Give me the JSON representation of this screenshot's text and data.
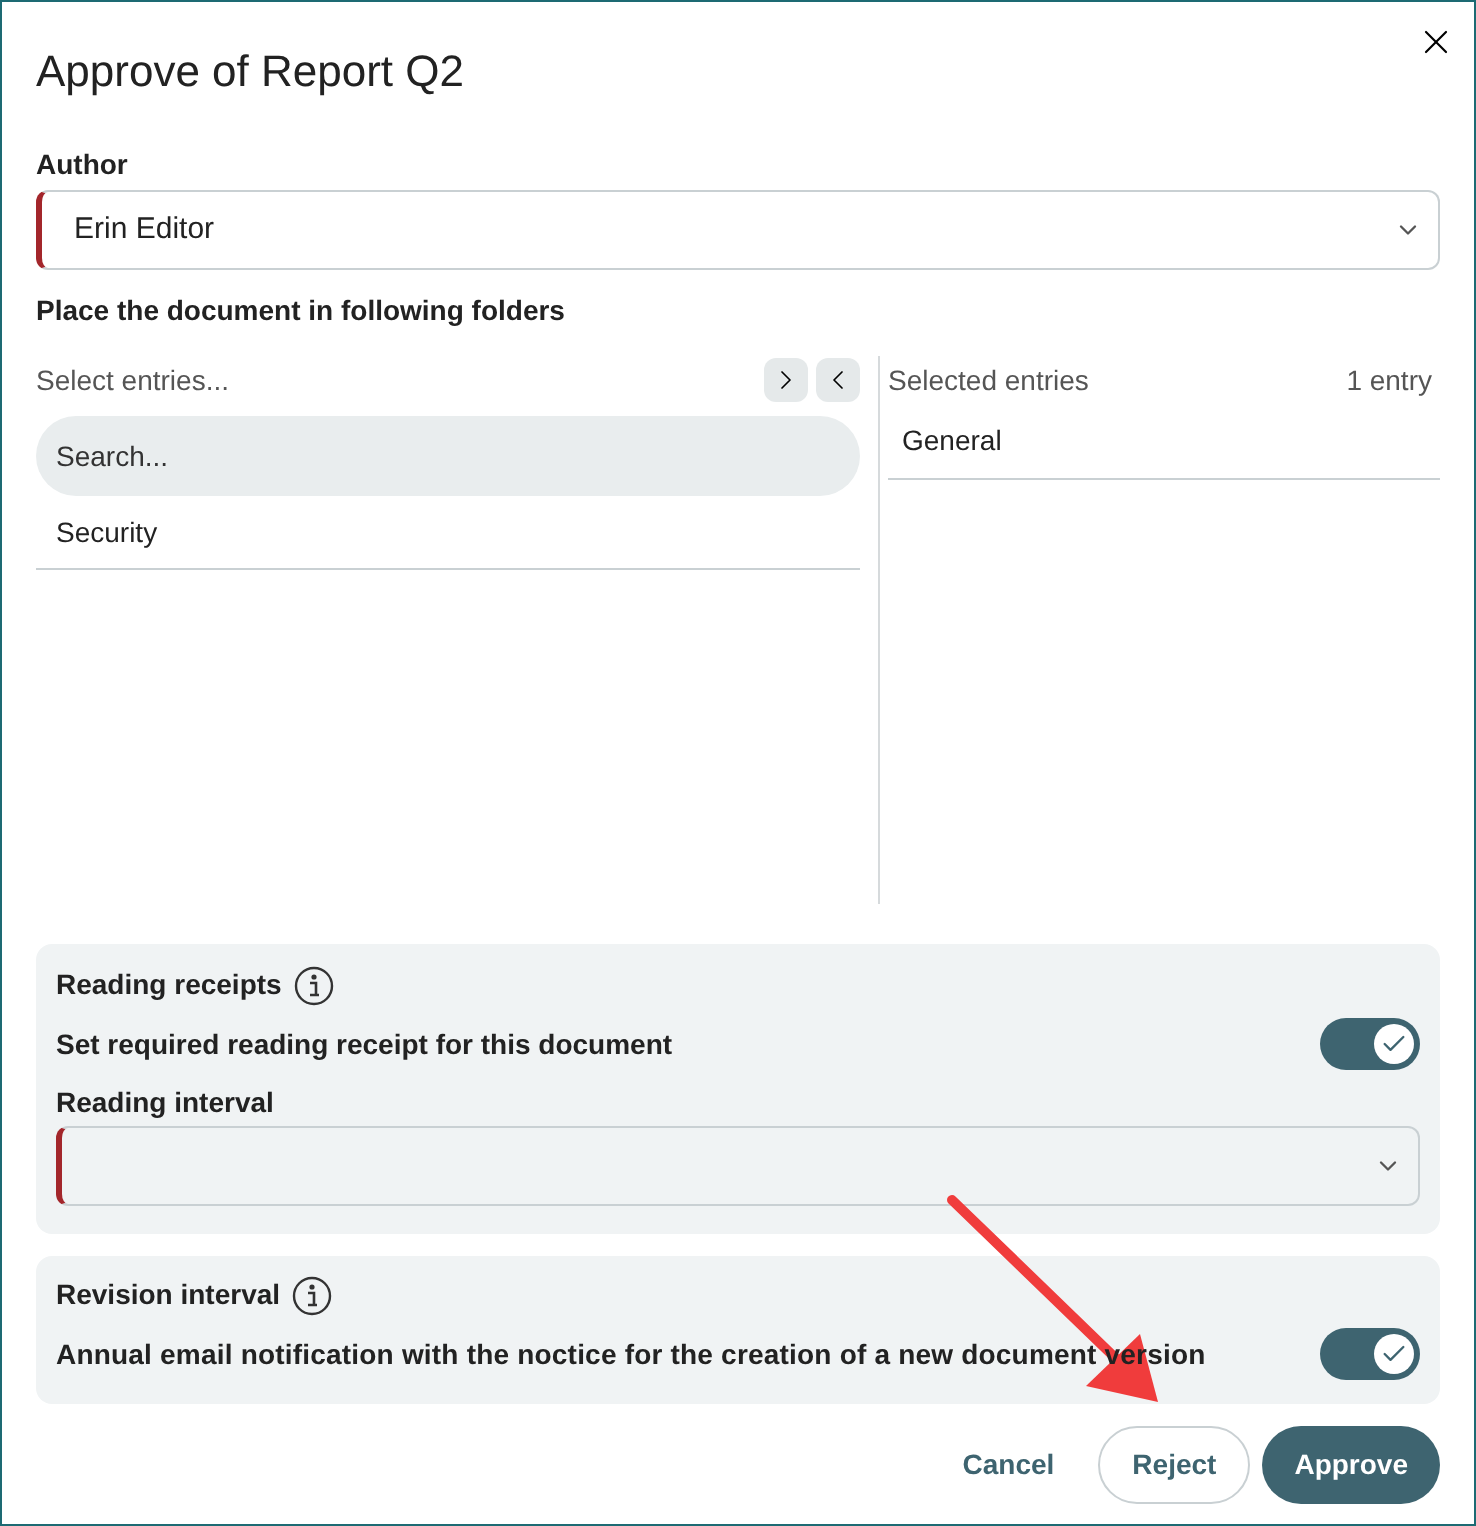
{
  "dialog": {
    "title": "Approve of Report Q2"
  },
  "author": {
    "label": "Author",
    "value": "Erin Editor",
    "required": true
  },
  "folders": {
    "label": "Place the document in following folders",
    "available": {
      "heading": "Select entries...",
      "search_placeholder": "Search...",
      "items": [
        "Security"
      ]
    },
    "selected": {
      "heading": "Selected entries",
      "count": "1 entry",
      "items": [
        "General"
      ]
    }
  },
  "reading_receipts": {
    "title": "Reading receipts",
    "toggle_label": "Set required reading receipt for this document",
    "on": true,
    "interval_label": "Reading interval",
    "interval_required": true
  },
  "revision": {
    "title": "Revision interval",
    "toggle_label": "Annual email notification with the noctice for the creation of a new document version",
    "on": true
  },
  "buttons": [
    {
      "label": "Cancel",
      "kind": "text"
    },
    {
      "label": "Reject",
      "kind": "outline"
    },
    {
      "label": "Approve",
      "kind": "primary"
    }
  ]
}
